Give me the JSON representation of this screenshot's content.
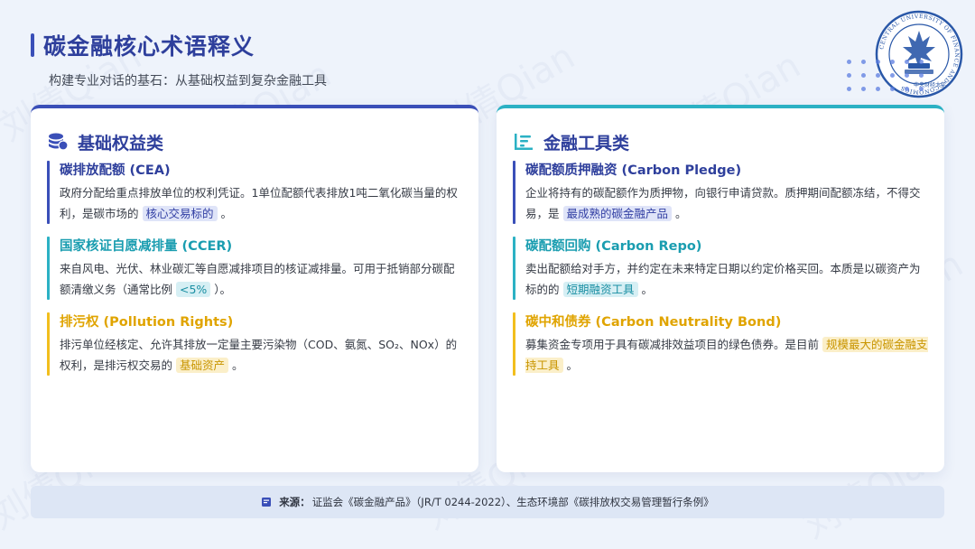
{
  "header": {
    "title": "碳金融核心术语释义",
    "subtitle": "构建专业对话的基石：从基础权益到复杂金融工具"
  },
  "watermark": "刘倩Qian",
  "logo": {
    "name": "university-seal",
    "ring_text": "CENTRAL UNIVERSITY OF FINANCE AND ECONOMICS",
    "inner_text": "中央财经大学"
  },
  "left_card": {
    "title": "基础权益类",
    "icon": "coins-stack-icon",
    "items": [
      {
        "title": "碳排放配额 (CEA)",
        "desc_before": "政府分配给重点排放单位的权利凭证。1单位配额代表排放1吨二氧化碳当量的权利，是碳市场的",
        "highlight": "核心交易标的",
        "desc_after": "。",
        "color": "#3a4fb8"
      },
      {
        "title": "国家核证自愿减排量 (CCER)",
        "desc_before": "来自风电、光伏、林业碳汇等自愿减排项目的核证减排量。可用于抵销部分碳配额清缴义务（通常比例",
        "highlight": "<5%",
        "desc_after": "）。",
        "color": "#2bb1c4"
      },
      {
        "title": "排污权 (Pollution Rights)",
        "desc_before": "排污单位经核定、允许其排放一定量主要污染物（COD、氨氮、SO₂、NOx）的权利，是排污权交易的",
        "highlight": "基础资产",
        "desc_after": "。",
        "color": "#f2be1d"
      }
    ]
  },
  "right_card": {
    "title": "金融工具类",
    "icon": "list-lines-icon",
    "items": [
      {
        "title": "碳配额质押融资 (Carbon Pledge)",
        "desc_before": "企业将持有的碳配额作为质押物，向银行申请贷款。质押期间配额冻结，不得交易，是",
        "highlight": "最成熟的碳金融产品",
        "desc_after": "。",
        "color": "#3a4fb8"
      },
      {
        "title": "碳配额回购 (Carbon Repo)",
        "desc_before": "卖出配额给对手方，并约定在未来特定日期以约定价格买回。本质是以碳资产为标的的",
        "highlight": "短期融资工具",
        "desc_after": "。",
        "color": "#2bb1c4"
      },
      {
        "title": "碳中和债券 (Carbon Neutrality Bond)",
        "desc_before": "募集资金专项用于具有碳减排效益项目的绿色债券。是目前",
        "highlight": "规模最大的碳金融支持工具",
        "desc_after": "。",
        "color": "#f2be1d"
      }
    ]
  },
  "footer": {
    "icon": "book-icon",
    "label": "来源：",
    "text": "证监会《碳金融产品》（JR/T 0244-2022）、生态环境部《碳排放权交易管理暂行条例》"
  }
}
